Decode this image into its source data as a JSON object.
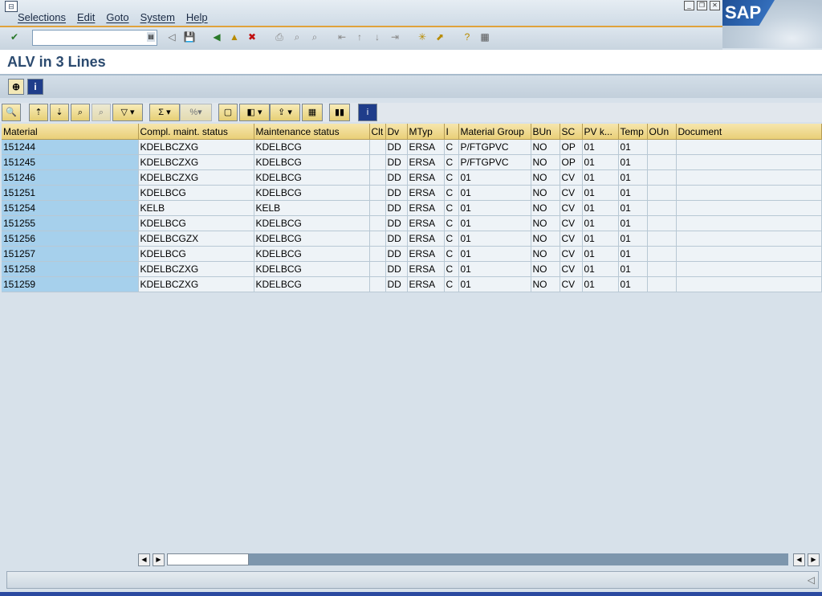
{
  "menu": {
    "items": [
      "Selections",
      "Edit",
      "Goto",
      "System",
      "Help"
    ]
  },
  "logo": {
    "text": "SAP"
  },
  "toolbar": {
    "command_field_value": "",
    "icons": [
      "check-icon",
      "back-icon",
      "save-icon",
      "navigate-back-icon",
      "exit-icon",
      "cancel-icon",
      "print-icon",
      "find-icon",
      "find-next-icon",
      "first-page-icon",
      "previous-page-icon",
      "next-page-icon",
      "last-page-icon",
      "create-session-icon",
      "shortcut-icon",
      "help-icon",
      "layout-icon"
    ]
  },
  "title": "ALV in 3 Lines",
  "grid": {
    "columns": [
      "Material",
      "Compl. maint. status",
      "Maintenance status",
      "Clt",
      "Dv",
      "MTyp",
      "I",
      "Material Group",
      "BUn",
      "SC",
      "PV k...",
      "Temp",
      "OUn",
      "Document"
    ],
    "rows": [
      [
        "151244",
        "KDELBCZXG",
        "KDELBCG",
        "",
        "DD",
        "ERSA",
        "C",
        "P/FTGPVC",
        "NO",
        "OP",
        "01",
        "01",
        "",
        ""
      ],
      [
        "151245",
        "KDELBCZXG",
        "KDELBCG",
        "",
        "DD",
        "ERSA",
        "C",
        "P/FTGPVC",
        "NO",
        "OP",
        "01",
        "01",
        "",
        ""
      ],
      [
        "151246",
        "KDELBCZXG",
        "KDELBCG",
        "",
        "DD",
        "ERSA",
        "C",
        "01",
        "NO",
        "CV",
        "01",
        "01",
        "",
        ""
      ],
      [
        "151251",
        "KDELBCG",
        "KDELBCG",
        "",
        "DD",
        "ERSA",
        "C",
        "01",
        "NO",
        "CV",
        "01",
        "01",
        "",
        ""
      ],
      [
        "151254",
        "KELB",
        "KELB",
        "",
        "DD",
        "ERSA",
        "C",
        "01",
        "NO",
        "CV",
        "01",
        "01",
        "",
        ""
      ],
      [
        "151255",
        "KDELBCG",
        "KDELBCG",
        "",
        "DD",
        "ERSA",
        "C",
        "01",
        "NO",
        "CV",
        "01",
        "01",
        "",
        ""
      ],
      [
        "151256",
        "KDELBCGZX",
        "KDELBCG",
        "",
        "DD",
        "ERSA",
        "C",
        "01",
        "NO",
        "CV",
        "01",
        "01",
        "",
        ""
      ],
      [
        "151257",
        "KDELBCG",
        "KDELBCG",
        "",
        "DD",
        "ERSA",
        "C",
        "01",
        "NO",
        "CV",
        "01",
        "01",
        "",
        ""
      ],
      [
        "151258",
        "KDELBCZXG",
        "KDELBCG",
        "",
        "DD",
        "ERSA",
        "C",
        "01",
        "NO",
        "CV",
        "01",
        "01",
        "",
        ""
      ],
      [
        "151259",
        "KDELBCZXG",
        "KDELBCG",
        "",
        "DD",
        "ERSA",
        "C",
        "01",
        "NO",
        "CV",
        "01",
        "01",
        "",
        ""
      ]
    ]
  },
  "status": {
    "message": ""
  }
}
